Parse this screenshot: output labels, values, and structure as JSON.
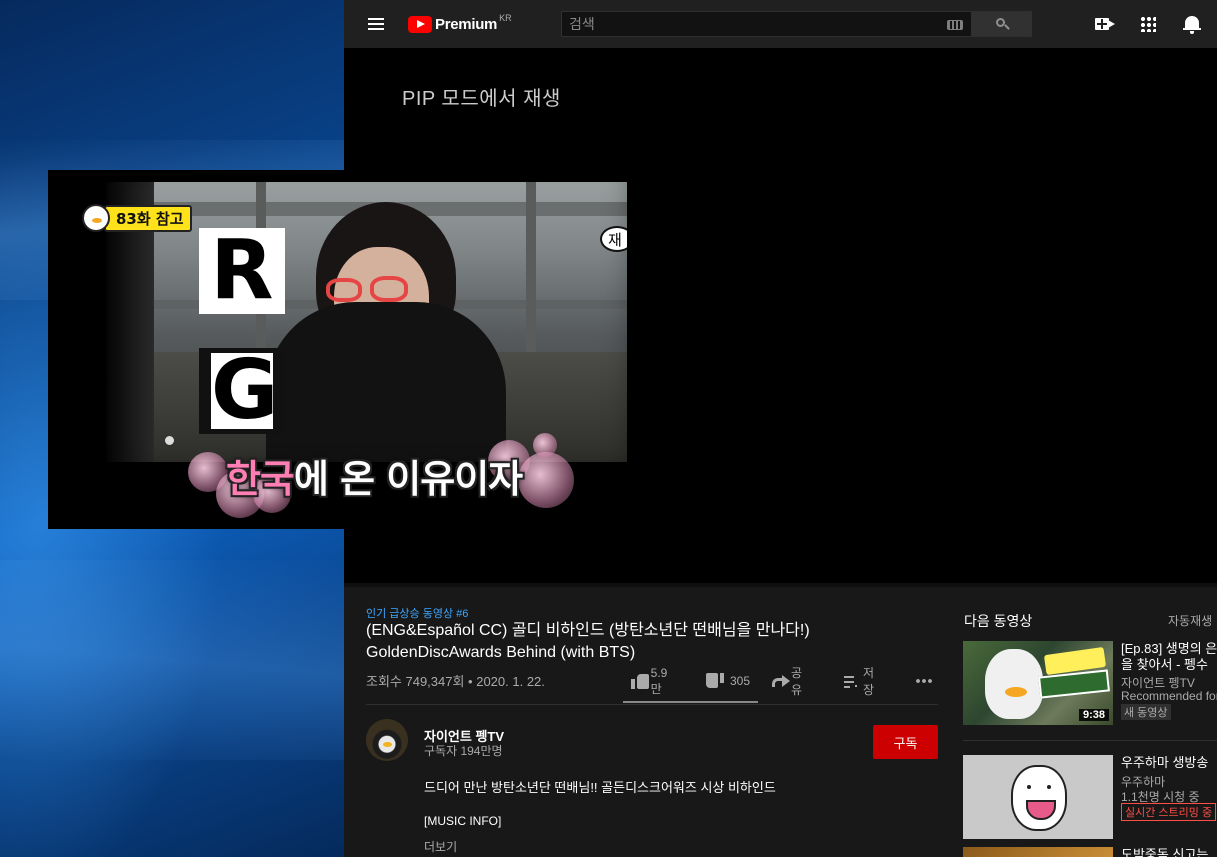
{
  "window": {
    "app": "YouTube Premium",
    "logo_text": "Premium",
    "logo_region": "KR"
  },
  "search": {
    "placeholder": "검색"
  },
  "player": {
    "pip_message": "PIP 모드에서 재생"
  },
  "pip_window": {
    "episode_badge": "83화 참고",
    "letter_r": "R",
    "letter_g": "G",
    "corner_mark": "재",
    "subtitle_highlight": "한국",
    "subtitle_rest": "에 온 이유이자"
  },
  "video": {
    "hashtag": "인기 급상승 동영상 #6",
    "title": "(ENG&Español CC) 골디 비하인드 (방탄소년단 떤배님을 만나다!) GoldenDiscAwards Behind (with BTS)",
    "views_date": "조회수 749,347회 • 2020. 1. 22.",
    "likes": "5.9만",
    "dislikes": "305",
    "share_label": "공유",
    "save_label": "저장"
  },
  "channel": {
    "name": "자이언트 펭TV",
    "subscribers": "구독자 194만명",
    "subscribe_label": "구독",
    "description_line1": "드디어 만난 방탄소년단 떤배님!! 골든디스크어워즈 시상 비하인드",
    "description_line2": "[MUSIC INFO]",
    "more_label": "더보기"
  },
  "sidebar": {
    "up_next": "다음 동영상",
    "autoplay": "자동재생",
    "items": [
      {
        "title_line1": "[Ep.83] 생명의 은",
        "title_line2": "을 찾아서 - 펭수",
        "channel": "자이언트 펭TV",
        "meta": "Recommended for",
        "badge": "새 동영상",
        "duration": "9:38"
      },
      {
        "title_line1": "우주하마 생방송",
        "channel": "우주하마",
        "meta": "1.1천명 시청 중",
        "badge": "실시간 스트리밍 중"
      },
      {
        "title_line1": "도박중독 신고는"
      }
    ]
  },
  "colors": {
    "accent_red": "#cc0000",
    "link_blue": "#3ea6ff",
    "live_red": "#ff4e45",
    "background": "#181818"
  }
}
